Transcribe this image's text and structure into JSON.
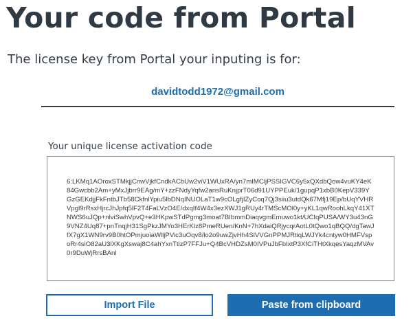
{
  "header": {
    "title": "Your code from Portal",
    "subtitle": "The license key from Portal your inputing is for:"
  },
  "account": {
    "email": "davidtodd1972@gmail.com"
  },
  "license": {
    "label": "Your unique license activation code",
    "code": "6:LKMq1AOroxSTMkjjCnwVjkfCndkACbUw2viV1WUxRA/yn7mIMCljPSSIGVC6y5xQXdbQow4vuKY4eK84Gwcbb2Am+yMxJjbrr9EAg/mY+zzFNdyYqfw2ansRuKnjprT06d91UYPPEuk/1gupqP1xbB0KepV339YGzGEKdjjFkFntbJTb58CkfnlYpiu5lbDNqINUOLaT1w9cOLgfjIZyCoq7Qj3siiu3utdQk67Mfj19Ep/bUqYVHRVpgl9rRsxHjrcJhJpfq5lF2T4FaLVzO4E/dxqIf4W4x3ezXWJ1gRUy4rTMScMOl0y+yKL1qwRoohLkqY41XTNWS6uJQp+nlviSwhVpvQ+e3HKpwSTdPgmg3moat7BIbmmDiaqvgmEmuwo1kt/UCIqPUSA/WY3u43nG9VNZ4Uq87+pnTnqjH31SgPkzJMYo3HErKlz8PmeRUen/KnN+7hXdaiQRjycqrAotL0tQwo1qBQQ/dgTawJfX7gX1WN9rv9B0htOPmjuoiaWlljPVic3uOqv8/lo2o9uwZjvHh4SlVVGnPPMJRtiqLWJYk4cntyw0HMFVspoRr4siO82aU3lXKgXswaj8C4ahYxnTtizP7FFJu+Q4BcVHDZsM0IVPuJbFbIxtP3XfCiTHtXkqesYaqzMVAv0r9DuWjRrsBAnl"
  },
  "actions": {
    "import_label": "Import File",
    "paste_label": "Paste from clipboard"
  },
  "colors": {
    "accent": "#1f6db1",
    "title": "#2f3a45",
    "divider": "#3b3b3b",
    "border": "#8a8a8a"
  }
}
